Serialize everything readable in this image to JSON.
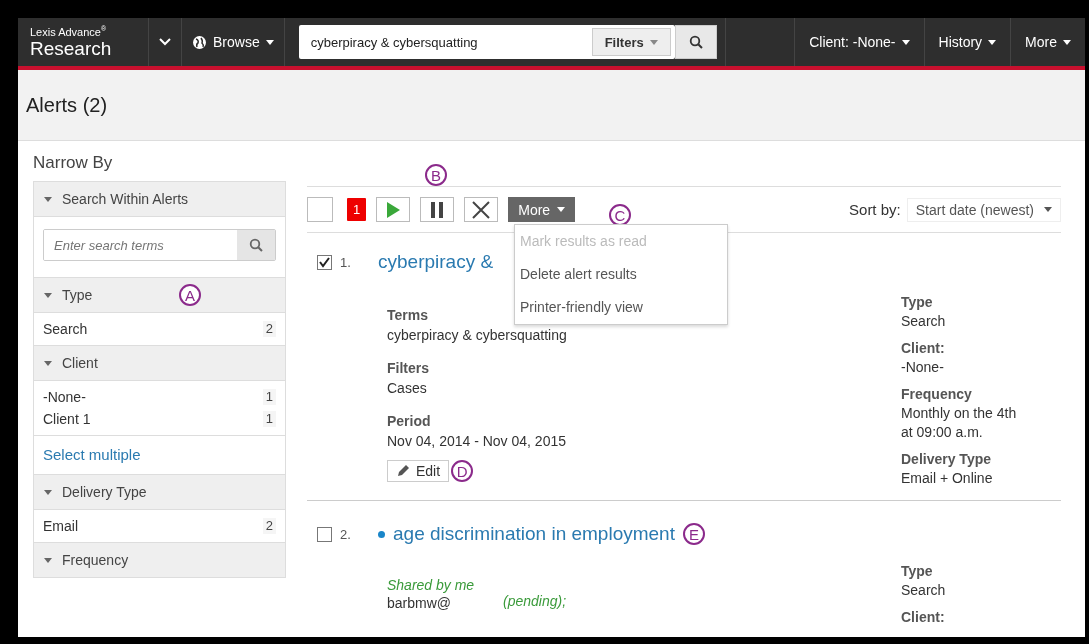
{
  "top_bar": {
    "brand_small": "Lexis Advance$^{®}$",
    "brand": "Research",
    "browse": "Browse",
    "search": {
      "value": "cyberpiracy & cybersquatting",
      "filters": "Filters"
    },
    "menus": [
      "Client: -None-",
      "History",
      "More"
    ]
  },
  "page_title": "Alerts (2)",
  "sidebar": {
    "title": "Narrow By",
    "sections": [
      {
        "title": "Search Within Alerts",
        "expanded": true,
        "kind": "search",
        "placeholder": "Enter search terms"
      },
      {
        "title": "Type",
        "expanded": true,
        "kind": "list",
        "annotation": "A",
        "items": [
          {
            "label": "Search",
            "count": "2"
          }
        ]
      },
      {
        "title": "Client",
        "expanded": true,
        "kind": "list",
        "items": [
          {
            "label": "-None-",
            "count": "1"
          },
          {
            "label": "Client 1",
            "count": "1"
          }
        ],
        "link": "Select multiple"
      },
      {
        "title": "Delivery Type",
        "expanded": true,
        "kind": "list",
        "items": [
          {
            "label": "Email",
            "count": "2"
          }
        ]
      },
      {
        "title": "Frequency",
        "expanded": true,
        "kind": "list"
      }
    ]
  },
  "toolbar": {
    "select_all_checked": false,
    "unread_count": "1",
    "buttons": [
      {
        "kind": "play"
      },
      {
        "kind": "pause",
        "annotation": "B"
      },
      {
        "kind": "delete"
      }
    ],
    "more": {
      "label": "More",
      "annotation": "C",
      "open": true,
      "items": [
        {
          "label": "Mark results as read",
          "disabled": true
        },
        {
          "label": "Delete alert results",
          "disabled": false
        },
        {
          "label": "Printer-friendly view",
          "disabled": false
        }
      ]
    },
    "sort": {
      "label": "Sort by:",
      "value": "Start date (newest)"
    }
  },
  "alerts": [
    {
      "number": "1.",
      "checked": true,
      "unread": false,
      "title": "cyberpiracy &",
      "details": [
        {
          "label": "Terms",
          "value": "cyberpiracy & cybersquatting"
        },
        {
          "label": "Filters",
          "value": "Cases"
        },
        {
          "label": "Period",
          "value": "Nov 04, 2014 - Nov 04, 2015"
        }
      ],
      "edit": {
        "label": "Edit",
        "annotation": "D"
      },
      "meta": [
        {
          "label": "Type",
          "lines": [
            "Search"
          ]
        },
        {
          "label": "Client:",
          "lines": [
            "-None-"
          ]
        },
        {
          "label": "Frequency",
          "lines": [
            "Monthly on the 4th",
            "at 09:00 a.m."
          ]
        },
        {
          "label": "Delivery Type",
          "lines": [
            "Email + Online"
          ]
        }
      ]
    },
    {
      "number": "2.",
      "checked": false,
      "unread": true,
      "title": "age discrimination in employment",
      "annotation": "E",
      "shared": {
        "label": "Shared by me",
        "user": "barbmw@",
        "status": "(pending);"
      },
      "meta": [
        {
          "label": "Type",
          "lines": [
            "Search"
          ]
        },
        {
          "label": "Client:"
        }
      ]
    }
  ]
}
